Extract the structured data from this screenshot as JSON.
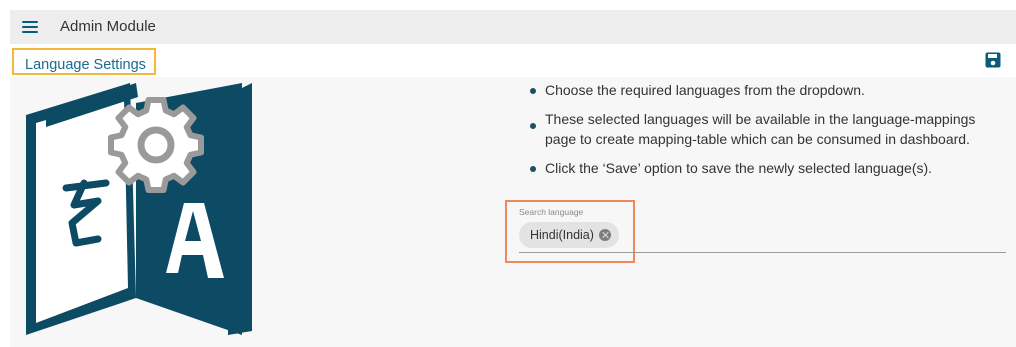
{
  "header": {
    "title": "Admin Module",
    "menu_icon": "hamburger-menu-icon"
  },
  "subheader": {
    "page_title": "Language Settings",
    "save_icon": "save-floppy-icon"
  },
  "illustration": {
    "icon": "language-translation-gear-icon",
    "glyph_left": "रे",
    "glyph_right": "A",
    "colors": {
      "book": "#0d4a64",
      "gear": "#9a9a9a"
    }
  },
  "instructions": [
    "Choose the required languages from the dropdown.",
    "These selected languages will be available in the language-mappings page to create mapping-table which can be consumed in dashboard.",
    "Click the ‘Save’ option to save the newly selected language(s)."
  ],
  "language_select": {
    "label": "Search language",
    "selected": [
      {
        "label": "Hindi(India)"
      }
    ]
  },
  "colors": {
    "accent": "#1c6a92",
    "title_highlight": "#f2b83a",
    "field_highlight": "#f0875d"
  }
}
